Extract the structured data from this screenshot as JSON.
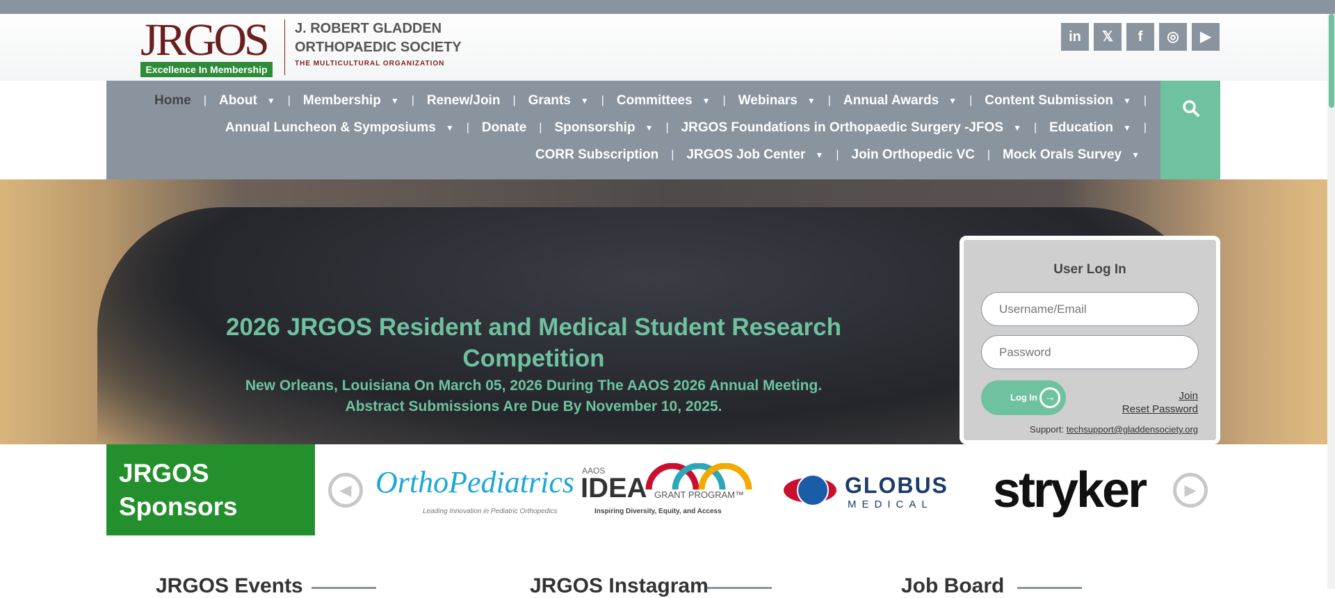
{
  "brand": {
    "logo_text": "JRGOS",
    "tagline": "Excellence In Membership",
    "org_line1": "J. ROBERT GLADDEN",
    "org_line2": "ORTHOPAEDIC SOCIETY",
    "org_subtitle": "THE MULTICULTURAL ORGANIZATION",
    "accent_color": "#6ec2a0",
    "brand_red": "#7a1f1f",
    "brand_green": "#2e8b3a"
  },
  "social": [
    {
      "icon": "linkedin-icon",
      "glyph": "in"
    },
    {
      "icon": "x-icon",
      "glyph": "𝕏"
    },
    {
      "icon": "facebook-icon",
      "glyph": "f"
    },
    {
      "icon": "instagram-icon",
      "glyph": "◎"
    },
    {
      "icon": "youtube-icon",
      "glyph": "▶"
    }
  ],
  "nav": {
    "row1": [
      "Home",
      "About",
      "Membership",
      "Renew/Join",
      "Grants",
      "Committees",
      "Webinars",
      "Annual Awards",
      "Content Submission"
    ],
    "row2": [
      "Annual Luncheon & Symposiums",
      "Donate",
      "Sponsorship",
      "JRGOS Foundations in Orthopaedic Surgery -JFOS",
      "Education"
    ],
    "row3": [
      "CORR Subscription",
      "JRGOS Job Center",
      "Join Orthopedic VC",
      "Mock Orals Survey"
    ]
  },
  "hero": {
    "title": "2026 JRGOS Resident and Medical Student Research Competition",
    "subtitle_line1": "New Orleans, Louisiana On March 05, 2026 During The AAOS 2026 Annual Meeting.",
    "subtitle_line2": "Abstract Submissions Are Due By November 10, 2025."
  },
  "login": {
    "title": "User Log In",
    "username_placeholder": "Username/Email",
    "password_placeholder": "Password",
    "button_label": "Log In",
    "join_label": "Join",
    "reset_label": "Reset Password",
    "support_label": "Support:",
    "support_email": "techsupport@gladdensociety.org"
  },
  "sponsors": {
    "heading_line1": "JRGOS",
    "heading_line2": "Sponsors",
    "logos": {
      "orthopediatrics": "OrthoPediatrics",
      "orthopediatrics_tag": "Leading Innovation in Pediatric Orthopedics",
      "idea_top": "AAOS",
      "idea_main": "IDEA",
      "idea_grant": "GRANT PROGRAM™",
      "idea_tag": "Inspiring Diversity, Equity, and Access",
      "globus_main": "GLOBUS",
      "globus_sub": "MEDICAL",
      "stryker": "stryker"
    }
  },
  "sections": {
    "events": "JRGOS Events",
    "instagram": "JRGOS Instagram",
    "jobs": "Job Board"
  }
}
